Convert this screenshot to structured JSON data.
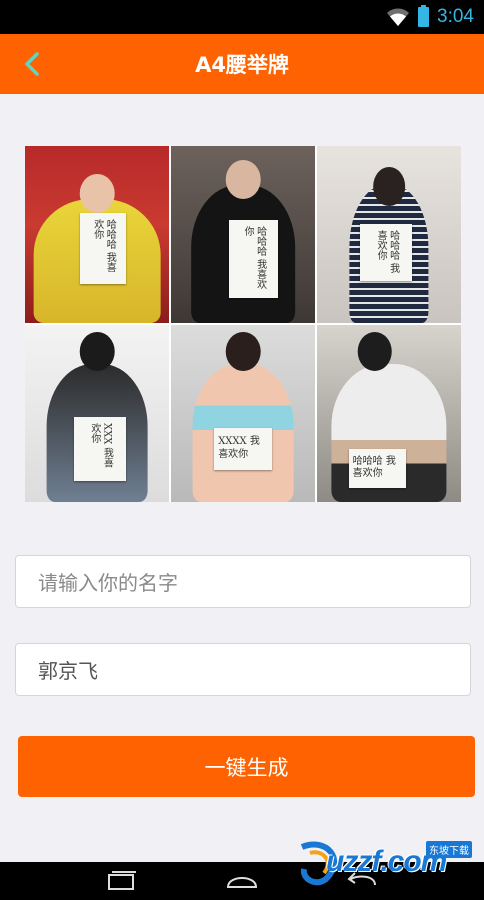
{
  "status_bar": {
    "time": "3:04"
  },
  "header": {
    "title": "A4腰举牌"
  },
  "photos": [
    {
      "sign": "哈哈哈 我喜欢你"
    },
    {
      "sign": "哈哈哈 我喜欢你"
    },
    {
      "sign": "哈哈哈 我喜欢你"
    },
    {
      "sign": "XXX 我喜欢你"
    },
    {
      "sign": "XXXX 我喜欢你"
    },
    {
      "sign": "哈哈哈 我喜欢你"
    }
  ],
  "form": {
    "name_input": {
      "placeholder": "请输入你的名字",
      "value": ""
    },
    "second_input": {
      "value": "郭京飞"
    },
    "generate_label": "一键生成"
  },
  "watermark": {
    "text": "uzzf.com",
    "sub": "东坡下载"
  },
  "colors": {
    "accent": "#ff6200",
    "status": "#33b5e5",
    "background": "#f1f1f5"
  }
}
